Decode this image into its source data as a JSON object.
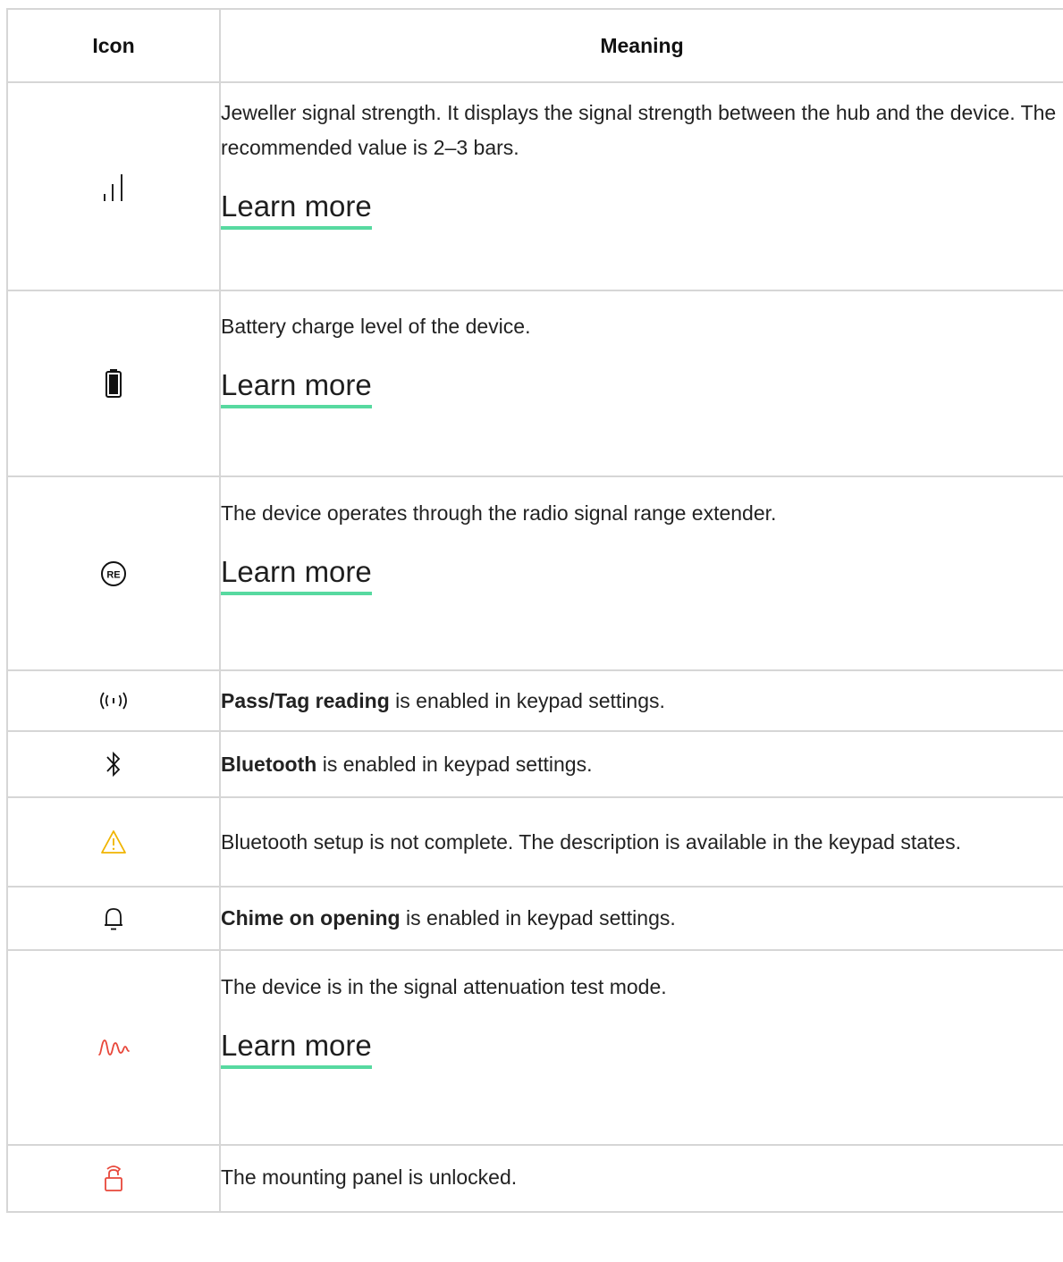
{
  "table": {
    "headers": {
      "icon": "Icon",
      "meaning": "Meaning"
    },
    "link_label": "Learn more",
    "link_underline_color": "#57d9a0",
    "rows": [
      {
        "icon": "signal-strength-icon",
        "text": "Jeweller signal strength. It displays the signal strength between the hub and the device. The recommended value is 2–3 bars.",
        "has_link": true
      },
      {
        "icon": "battery-icon",
        "text": "Battery charge level of the device.",
        "has_link": true
      },
      {
        "icon": "range-extender-icon",
        "icon_text": "RE",
        "text": "The device operates through the radio signal range extender.",
        "has_link": true
      },
      {
        "icon": "pass-tag-reading-icon",
        "bold": "Pass/Tag reading",
        "text": " is enabled in keypad settings.",
        "has_link": false
      },
      {
        "icon": "bluetooth-icon",
        "bold": "Bluetooth",
        "text": " is enabled in keypad settings.",
        "has_link": false
      },
      {
        "icon": "warning-icon",
        "icon_color": "#f0b400",
        "text": "Bluetooth setup is not complete. The description is available in the keypad states.",
        "has_link": false
      },
      {
        "icon": "bell-icon",
        "bold": "Chime on opening",
        "text": " is enabled in keypad settings.",
        "has_link": false
      },
      {
        "icon": "signal-attenuation-icon",
        "icon_color": "#e8473a",
        "text": "The device is in the signal attenuation test mode.",
        "has_link": true
      },
      {
        "icon": "unlocked-panel-icon",
        "icon_color": "#e8473a",
        "text": "The mounting panel is unlocked.",
        "has_link": false
      }
    ]
  }
}
